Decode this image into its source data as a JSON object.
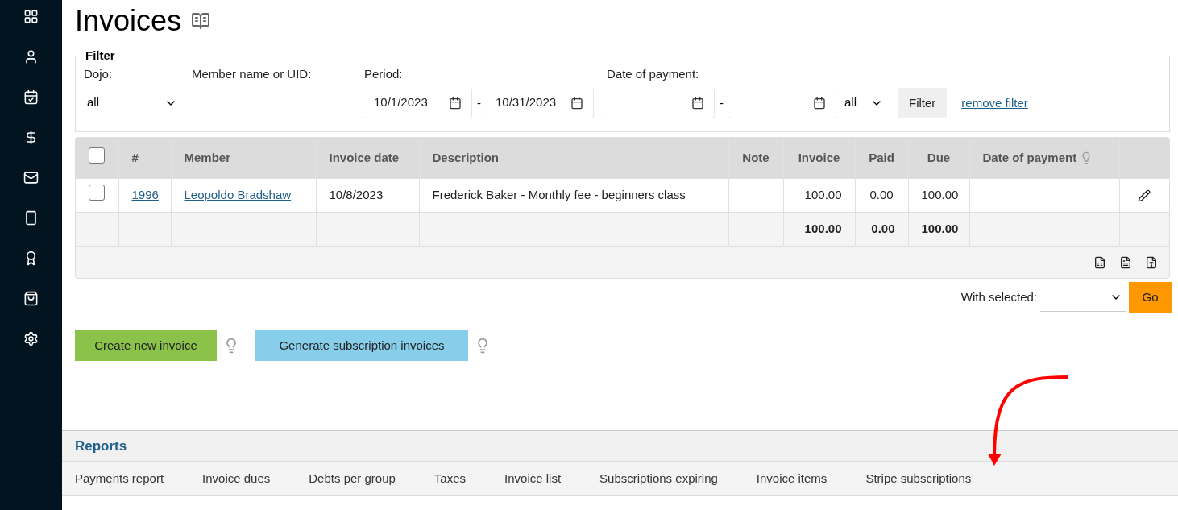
{
  "title": "Invoices",
  "filter": {
    "legend": "Filter",
    "dojo": {
      "label": "Dojo:",
      "value": "all"
    },
    "member": {
      "label": "Member name or UID:"
    },
    "period": {
      "label": "Period:",
      "from": "10/1/2023",
      "separator": "-",
      "to": "10/31/2023"
    },
    "payment": {
      "label": "Date of payment:",
      "separator": "-",
      "status": "all"
    },
    "filter_button": "Filter",
    "remove_link": "remove filter"
  },
  "table": {
    "select_all_checked": false,
    "columns": [
      "#",
      "Member",
      "Invoice date",
      "Description",
      "Note",
      "Invoice",
      "Paid",
      "Due",
      "Date of payment"
    ],
    "rows": [
      {
        "checked": false,
        "number": "1996",
        "member": "Leopoldo Bradshaw",
        "date": "10/8/2023",
        "description": "Frederick Baker - Monthly fee - beginners class",
        "invoice": "100.00",
        "paid": "0.00",
        "due": "100.00"
      }
    ],
    "totals": {
      "invoice": "100.00",
      "paid": "0.00",
      "due": "100.00"
    }
  },
  "with_selected": {
    "label": "With selected:",
    "go": "Go"
  },
  "buttons": [
    {
      "label": "Create new invoice",
      "kind": "create"
    },
    {
      "label": "Generate subscription invoices",
      "kind": "generate"
    }
  ],
  "reports": {
    "title": "Reports",
    "links": [
      "Payments report",
      "Invoice dues",
      "Debts per group",
      "Taxes",
      "Invoice list",
      "Subscriptions expiring",
      "Invoice items",
      "Stripe subscriptions"
    ]
  }
}
